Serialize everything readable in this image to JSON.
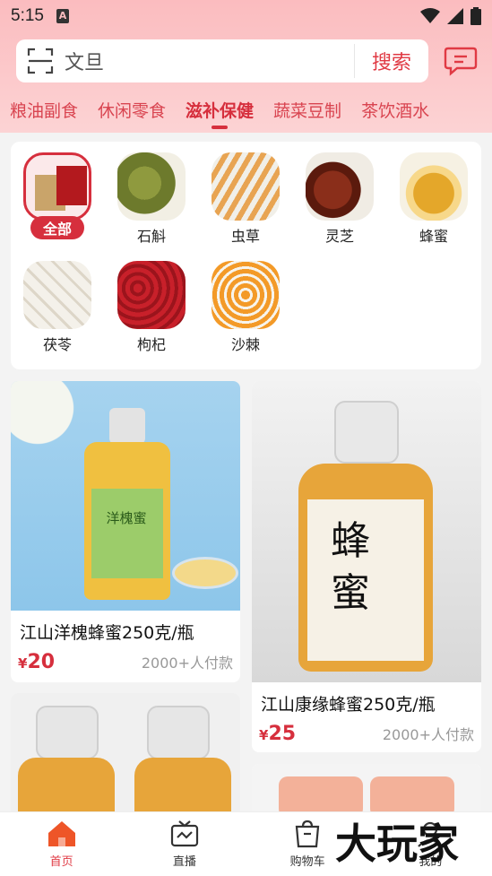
{
  "status": {
    "time": "5:15",
    "badge": "A"
  },
  "search": {
    "value": "文旦",
    "button": "搜索"
  },
  "categories": [
    "粮油副食",
    "休闲零食",
    "滋补保健",
    "蔬菜豆制",
    "茶饮酒水"
  ],
  "active_category": "滋补保健",
  "subcategories": [
    "全部",
    "石斛",
    "虫草",
    "灵芝",
    "蜂蜜",
    "茯苓",
    "枸杞",
    "沙棘"
  ],
  "products": [
    {
      "title": "江山洋槐蜂蜜250克/瓶",
      "currency": "¥",
      "price": "20",
      "sold": "2000+人付款",
      "bottle_label": "洋槐蜜"
    },
    {
      "title": "江山康缘蜂蜜250克/瓶",
      "currency": "¥",
      "price": "25",
      "sold": "2000+人付款",
      "bottle_label": "蜂蜜"
    }
  ],
  "tabs": [
    "首页",
    "直播",
    "购物车",
    "我的"
  ],
  "watermark": "大玩家",
  "colors": {
    "accent": "#d62f3d",
    "header_bg": "#fbbcbf"
  }
}
